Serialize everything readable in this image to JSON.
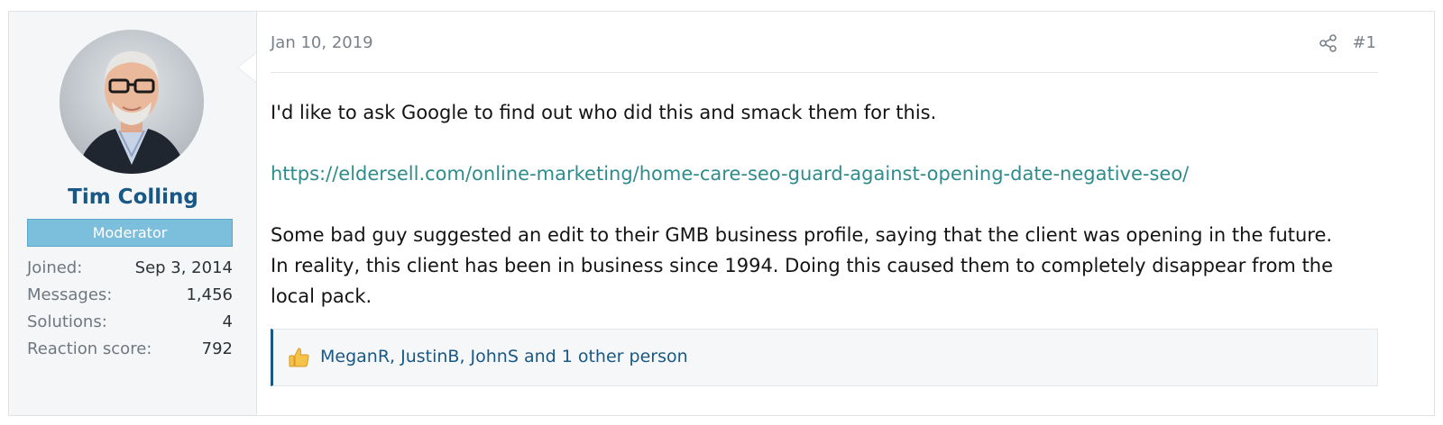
{
  "post": {
    "date": "Jan 10, 2019",
    "number": "#1",
    "body": {
      "paragraph1": "I'd like to ask Google to find out who did this and smack them for this.",
      "link": "https://eldersell.com/online-marketing/home-care-seo-guard-against-opening-date-negative-seo/",
      "paragraph3_line1": "Some bad guy suggested an edit to their GMB business profile, saying that the client was opening in the future.",
      "paragraph3_line2": "In reality, this client has been in business since 1994. Doing this caused them to completely disappear from the",
      "paragraph3_line3": "local pack."
    },
    "reactions": {
      "icon": "thumbs-up-icon",
      "text": "MeganR, JustinB, JohnS and 1 other person"
    }
  },
  "user": {
    "name": "Tim Colling",
    "role": "Moderator",
    "stats": [
      {
        "label": "Joined:",
        "value": "Sep 3, 2014"
      },
      {
        "label": "Messages:",
        "value": "1,456"
      },
      {
        "label": "Solutions:",
        "value": "4"
      },
      {
        "label": "Reaction score:",
        "value": "792"
      }
    ]
  },
  "colors": {
    "username": "#185886",
    "role_badge": "#7bbfdc",
    "link": "#2f8c8c",
    "reaction_border": "#185886"
  }
}
